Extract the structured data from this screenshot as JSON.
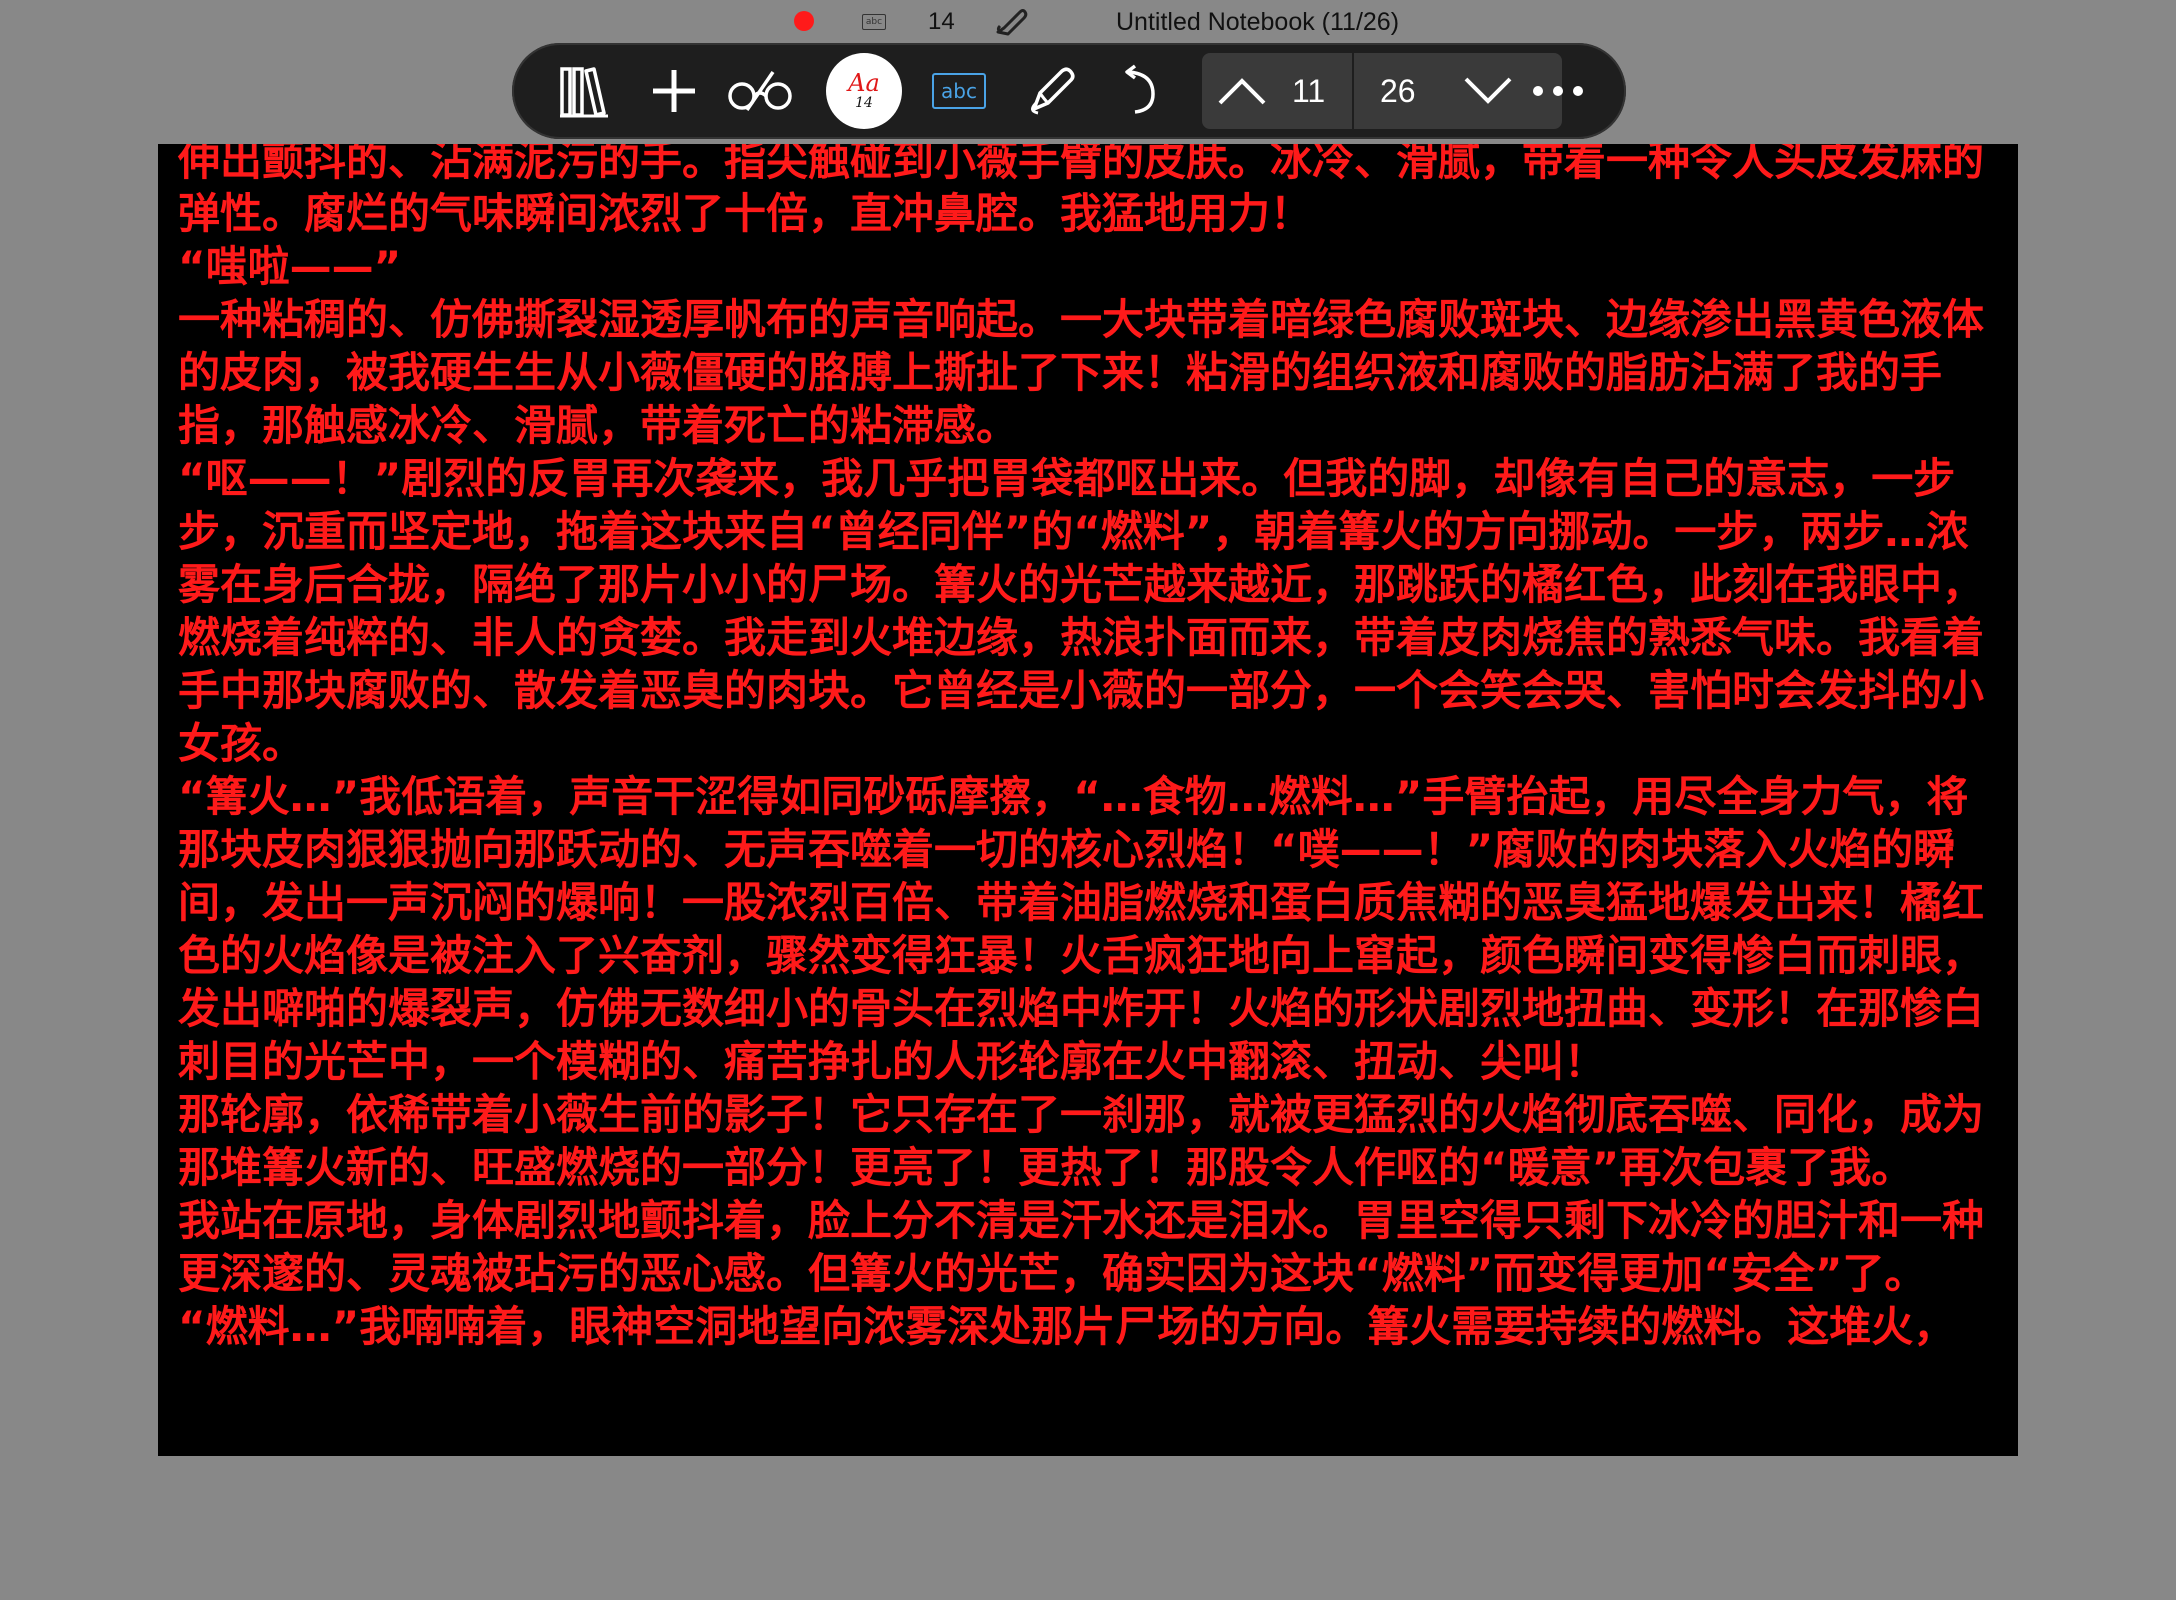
{
  "status": {
    "font_size": "14",
    "mini_abc": "abc",
    "title": "Untitled Notebook (11/26)",
    "record_color": "#ff1a1a"
  },
  "toolbar": {
    "library_icon": "books-icon",
    "add_icon": "plus-icon",
    "glasses_icon": "glasses-icon",
    "font_label": "Aa",
    "font_size": "14",
    "text_box_label": "abc",
    "pen_icon": "pen-icon",
    "undo_icon": "undo-icon",
    "page_current": "11",
    "page_total": "26",
    "more_icon": "more-icon"
  },
  "content": {
    "paragraphs": [
      "伸出颤抖的、沾满泥污的手。指尖触碰到小薇手臂的皮肤。冰冷、滑腻，带着一种令人头皮发麻的弹性。腐烂的气味瞬间浓烈了十倍，直冲鼻腔。我猛地用力！",
      "“嗤啦——”",
      "一种粘稠的、仿佛撕裂湿透厚帆布的声音响起。一大块带着暗绿色腐败斑块、边缘渗出黑黄色液体的皮肉，被我硬生生从小薇僵硬的胳膊上撕扯了下来！粘滑的组织液和腐败的脂肪沾满了我的手指，那触感冰冷、滑腻，带着死亡的粘滞感。",
      "“呕——！”剧烈的反胃再次袭来，我几乎把胃袋都呕出来。但我的脚，却像有自己的意志，一步步，沉重而坚定地，拖着这块来自“曾经同伴”的“燃料”，朝着篝火的方向挪动。一步，两步…浓雾在身后合拢，隔绝了那片小小的尸场。篝火的光芒越来越近，那跳跃的橘红色，此刻在我眼中，燃烧着纯粹的、非人的贪婪。我走到火堆边缘，热浪扑面而来，带着皮肉烧焦的熟悉气味。我看着手中那块腐败的、散发着恶臭的肉块。它曾经是小薇的一部分，一个会笑会哭、害怕时会发抖的小女孩。",
      "“篝火…”我低语着，声音干涩得如同砂砾摩擦，“…食物…燃料…”手臂抬起，用尽全身力气，将那块皮肉狠狠抛向那跃动的、无声吞噬着一切的核心烈焰！“噗——！”腐败的肉块落入火焰的瞬间，发出一声沉闷的爆响！一股浓烈百倍、带着油脂燃烧和蛋白质焦糊的恶臭猛地爆发出来！橘红色的火焰像是被注入了兴奋剂，骤然变得狂暴！火舌疯狂地向上窜起，颜色瞬间变得惨白而刺眼，发出噼啪的爆裂声，仿佛无数细小的骨头在烈焰中炸开！火焰的形状剧烈地扭曲、变形！在那惨白刺目的光芒中，一个模糊的、痛苦挣扎的人形轮廓在火中翻滚、扭动、尖叫！",
      "那轮廓，依稀带着小薇生前的影子！它只存在了一刹那，就被更猛烈的火焰彻底吞噬、同化，成为那堆篝火新的、旺盛燃烧的一部分！更亮了！更热了！那股令人作呕的“暖意”再次包裹了我。",
      "我站在原地，身体剧烈地颤抖着，脸上分不清是汗水还是泪水。胃里空得只剩下冰冷的胆汁和一种更深邃的、灵魂被玷污的恶心感。但篝火的光芒，确实因为这块“燃料”而变得更加“安全”了。",
      "“燃料…”我喃喃着，眼神空洞地望向浓雾深处那片尸场的方向。篝火需要持续的燃料。这堆火，"
    ]
  }
}
